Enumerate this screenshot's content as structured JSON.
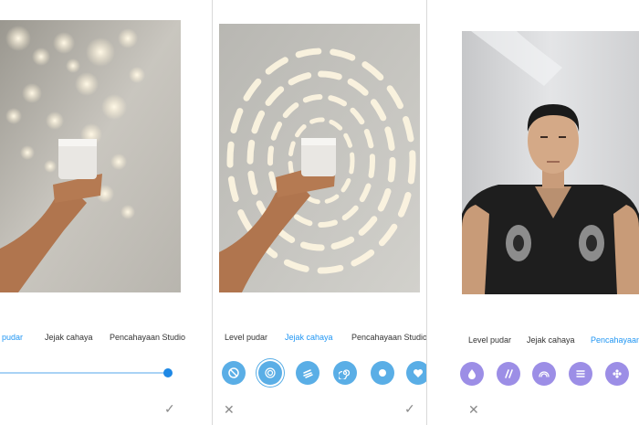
{
  "panels": [
    {
      "tabs": [
        "pudar",
        "Jejak cahaya",
        "Pencahayaan Studio"
      ],
      "active_tab": 0,
      "slider_value": 1.0,
      "actions": {
        "confirm": "✓"
      }
    },
    {
      "tabs": [
        "Level pudar",
        "Jejak cahaya",
        "Pencahayaan Studio"
      ],
      "active_tab": 1,
      "effects": [
        "no-effect-icon",
        "ring-icon",
        "streaks-icon",
        "spiral-icon",
        "dot-icon",
        "heart-icon"
      ],
      "selected_effect": 1,
      "actions": {
        "cancel": "✕",
        "confirm": "✓"
      }
    },
    {
      "tabs": [
        "Level pudar",
        "Jejak cahaya",
        "Pencahayaan Studio"
      ],
      "active_tab": 2,
      "effects": [
        "drop-icon",
        "slashes-icon",
        "rainbow-icon",
        "lines-icon",
        "flower-icon"
      ],
      "actions": {
        "cancel": "✕"
      }
    }
  ],
  "colors": {
    "accent": "#2196f3",
    "effect_blue": "#5aaee6",
    "effect_purple": "#9c8ee6",
    "slider_track": "#a9d2f5",
    "slider_thumb": "#1e88e5"
  }
}
